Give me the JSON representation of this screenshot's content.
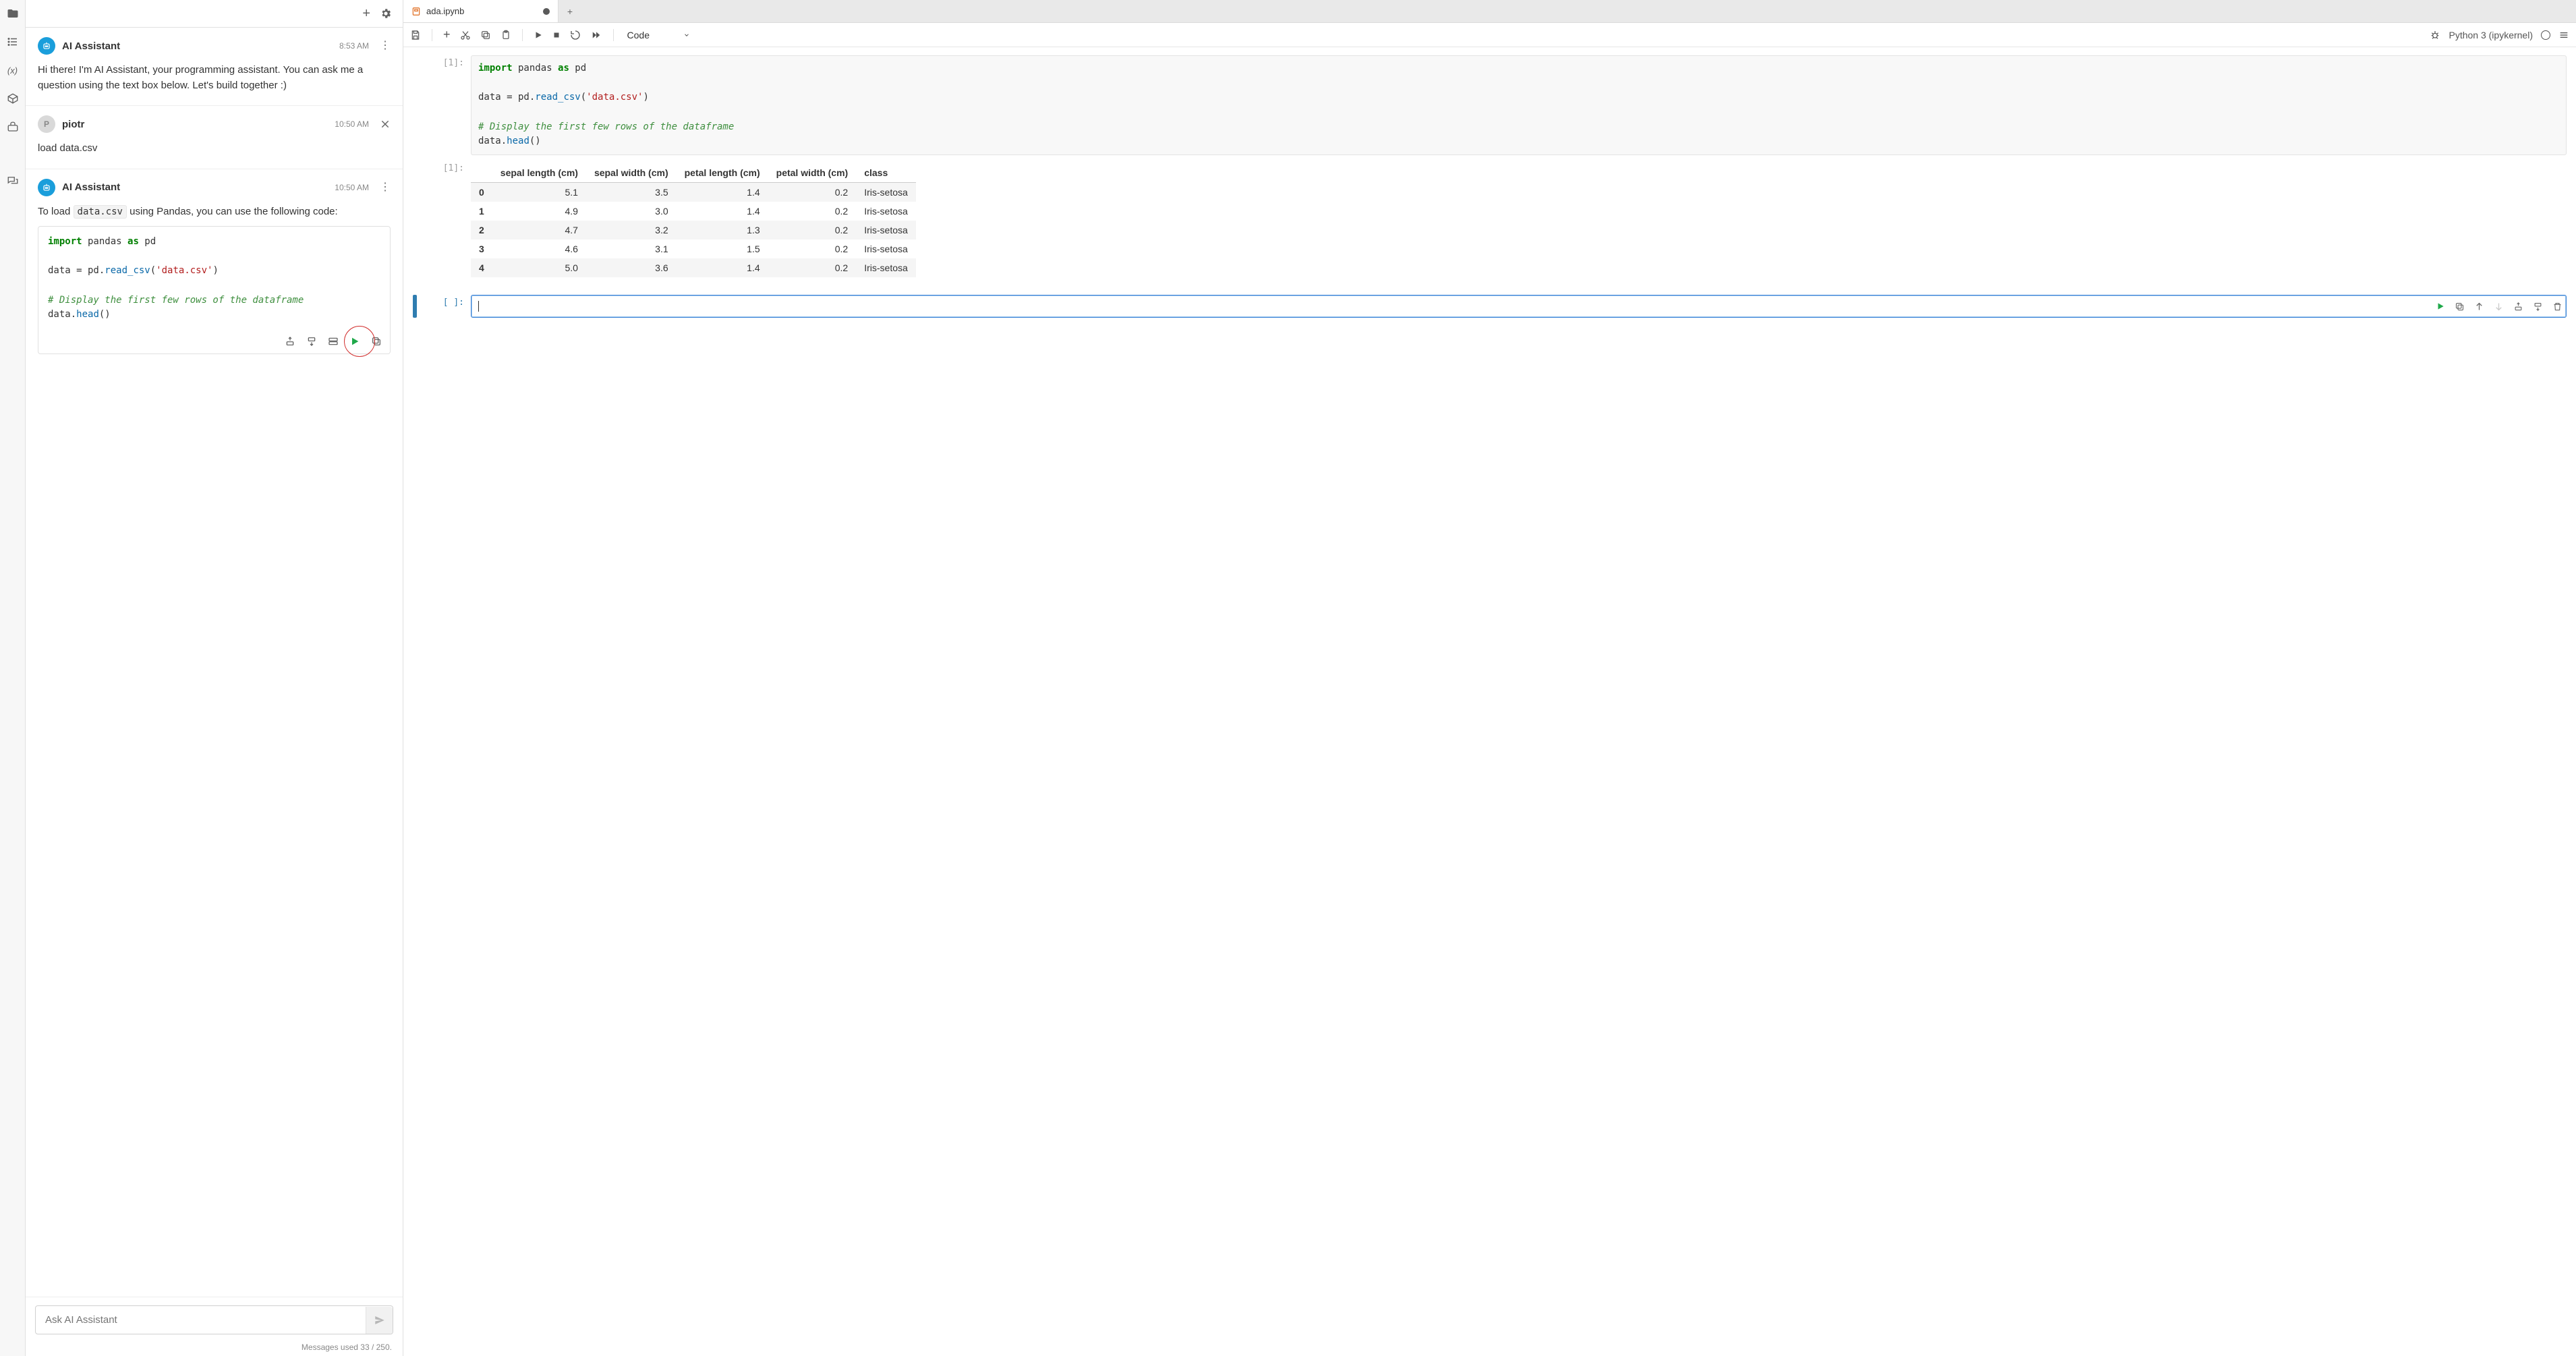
{
  "activity_bar": {
    "items": [
      "folder-icon",
      "list-icon",
      "variable-icon",
      "extensions-icon",
      "toolbox-icon"
    ],
    "bottom_item": "chat-icon"
  },
  "chat": {
    "toolbar": {
      "new": "+",
      "settings": "gear"
    },
    "messages": [
      {
        "sender": "AI Assistant",
        "avatar": "ai",
        "time": "8:53 AM",
        "menu": "kebab",
        "body_plain": "Hi there! I'm AI Assistant, your programming assistant. You can ask me a question using the text box below. Let's build together :)"
      },
      {
        "sender": "piotr",
        "avatar_letter": "P",
        "time": "10:50 AM",
        "menu": "close",
        "body_plain": "load data.csv"
      },
      {
        "sender": "AI Assistant",
        "avatar": "ai",
        "time": "10:50 AM",
        "menu": "kebab",
        "intro_pre": "To load ",
        "intro_code": "data.csv",
        "intro_post": " using Pandas, you can use the following code:",
        "code": {
          "line1_kw": "import",
          "line1_rest": " pandas ",
          "line1_kw2": "as",
          "line1_rest2": " pd",
          "line2_a": "data = pd.",
          "line2_fn": "read_csv",
          "line2_paren_open": "(",
          "line2_str": "'data.csv'",
          "line2_paren_close": ")",
          "line3_comment": "# Display the first few rows of the dataframe",
          "line4_a": "data.",
          "line4_fn": "head",
          "line4_rest": "()"
        },
        "code_actions": [
          "insert-above",
          "insert-below",
          "insert-replace",
          "run",
          "copy"
        ]
      }
    ],
    "input_placeholder": "Ask AI Assistant",
    "footer": "Messages used 33 / 250."
  },
  "notebook": {
    "tab": {
      "title": "ada.ipynb",
      "dirty": true
    },
    "toolbar": {
      "celltype": "Code",
      "kernel": "Python 3 (ipykernel)"
    },
    "cell_in": {
      "prompt": "[1]:",
      "line1_kw": "import",
      "line1_rest": " pandas ",
      "line1_kw2": "as",
      "line1_rest2": " pd",
      "line2_a": "data = pd.",
      "line2_fn": "read_csv",
      "line2_paren_open": "(",
      "line2_str": "'data.csv'",
      "line2_paren_close": ")",
      "line3_comment": "# Display the first few rows of the dataframe",
      "line4_a": "data.",
      "line4_fn": "head",
      "line4_rest": "()"
    },
    "cell_out": {
      "prompt": "[1]:",
      "columns": [
        "",
        "sepal length (cm)",
        "sepal width (cm)",
        "petal length (cm)",
        "petal width (cm)",
        "class"
      ],
      "rows": [
        [
          "0",
          "5.1",
          "3.5",
          "1.4",
          "0.2",
          "Iris-setosa"
        ],
        [
          "1",
          "4.9",
          "3.0",
          "1.4",
          "0.2",
          "Iris-setosa"
        ],
        [
          "2",
          "4.7",
          "3.2",
          "1.3",
          "0.2",
          "Iris-setosa"
        ],
        [
          "3",
          "4.6",
          "3.1",
          "1.5",
          "0.2",
          "Iris-setosa"
        ],
        [
          "4",
          "5.0",
          "3.6",
          "1.4",
          "0.2",
          "Iris-setosa"
        ]
      ]
    },
    "cell_empty": {
      "prompt": "[ ]:",
      "toolbar": [
        "run",
        "duplicate",
        "move-up",
        "move-down",
        "insert-above",
        "insert-below",
        "delete"
      ]
    }
  }
}
